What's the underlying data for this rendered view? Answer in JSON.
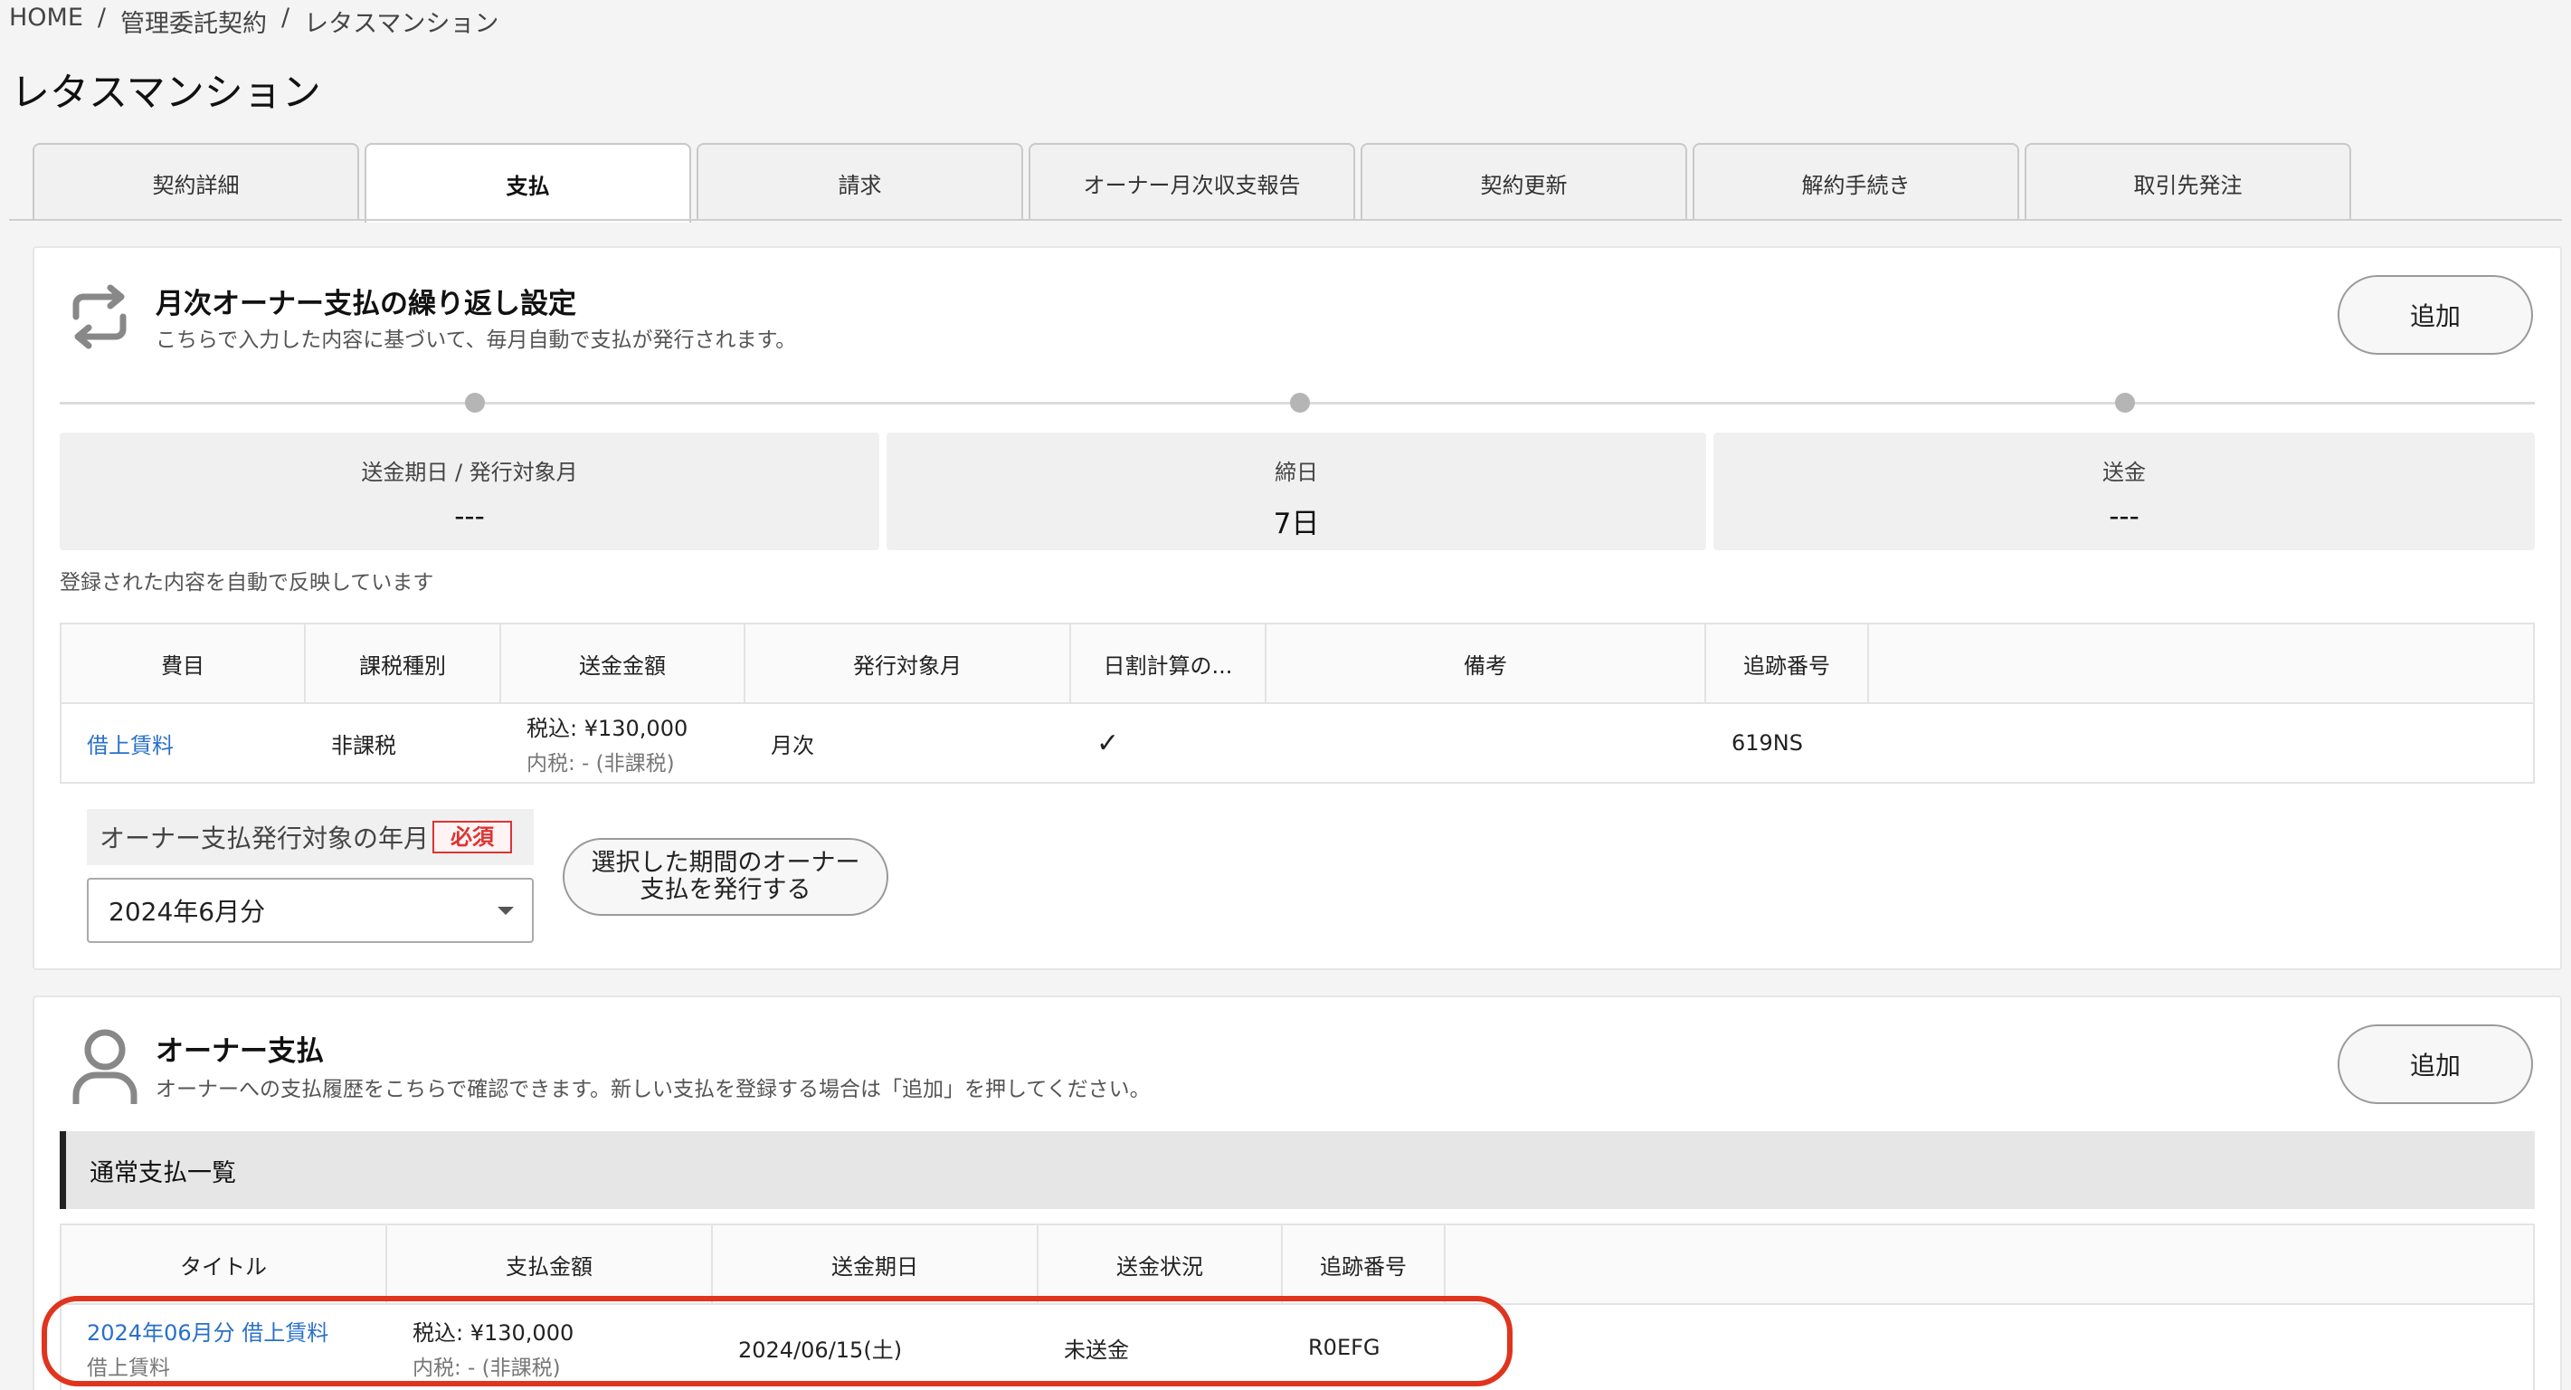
{
  "breadcrumb": {
    "items": [
      "HOME",
      "管理委託契約",
      "レタスマンション"
    ],
    "separator": "/"
  },
  "page_title": "レタスマンション",
  "tabs": [
    {
      "label": "契約詳細",
      "active": false
    },
    {
      "label": "支払",
      "active": true
    },
    {
      "label": "請求",
      "active": false
    },
    {
      "label": "オーナー月次収支報告",
      "active": false
    },
    {
      "label": "契約更新",
      "active": false
    },
    {
      "label": "解約手続き",
      "active": false
    },
    {
      "label": "取引先発注",
      "active": false
    }
  ],
  "recurring": {
    "icon": "repeat-icon",
    "title": "月次オーナー支払の繰り返し設定",
    "subtitle": "こちらで入力した内容に基づいて、毎月自動で支払が発行されます。",
    "add_label": "追加",
    "stats": [
      {
        "label": "送金期日 / 発行対象月",
        "value": "---"
      },
      {
        "label": "締日",
        "value": "7日"
      },
      {
        "label": "送金",
        "value": "---"
      }
    ],
    "note": "登録された内容を自動で反映しています",
    "table": {
      "headers": [
        "費目",
        "課税種別",
        "送金金額",
        "発行対象月",
        "日割計算の...",
        "備考",
        "追跡番号"
      ],
      "rows": [
        {
          "item": "借上賃料",
          "tax_type": "非課税",
          "amount": "税込: ¥130,000",
          "amount_sub": "内税: - (非課税)",
          "target_month": "月次",
          "prorate": "✓",
          "memo": "",
          "tracking": "619NS"
        }
      ]
    },
    "issue_field": {
      "label": "オーナー支払発行対象の年月",
      "required": "必須",
      "value": "2024年6月分"
    },
    "issue_button": "選択した期間のオーナー支払を発行する"
  },
  "owner_payment": {
    "icon": "user-icon",
    "title": "オーナー支払",
    "subtitle": "オーナーへの支払履歴をこちらで確認できます。新しい支払を登録する場合は「追加」を押してください。",
    "add_label": "追加",
    "list_title": "通常支払一覧",
    "table": {
      "headers": [
        "タイトル",
        "支払金額",
        "送金期日",
        "送金状況",
        "追跡番号"
      ],
      "rows": [
        {
          "title": "2024年06月分 借上賃料",
          "title_sub": "借上賃料",
          "amount": "税込: ¥130,000",
          "amount_sub": "内税: - (非課税)",
          "due_date": "2024/06/15(土)",
          "status": "未送金",
          "tracking": "R0EFG"
        }
      ]
    }
  },
  "colors": {
    "link": "#2a6fc9",
    "required": "#d33333",
    "highlight": "#e0341e"
  }
}
